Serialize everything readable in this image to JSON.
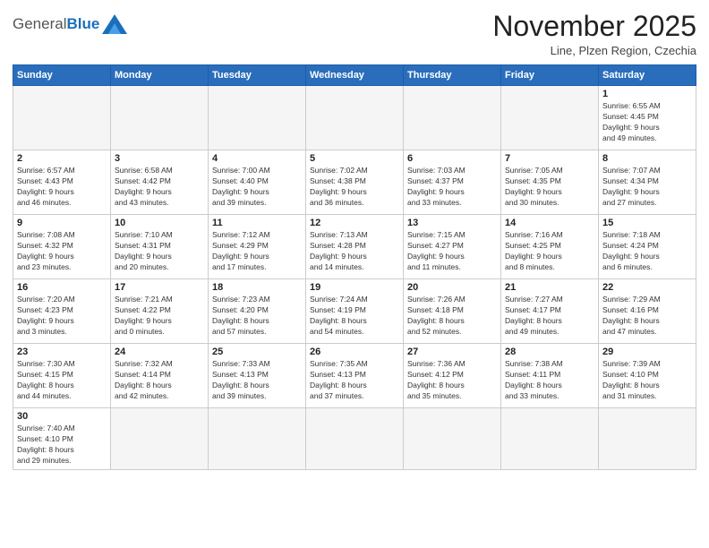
{
  "header": {
    "logo_general": "General",
    "logo_blue": "Blue",
    "title": "November 2025",
    "subtitle": "Line, Plzen Region, Czechia"
  },
  "weekdays": [
    "Sunday",
    "Monday",
    "Tuesday",
    "Wednesday",
    "Thursday",
    "Friday",
    "Saturday"
  ],
  "weeks": [
    [
      {
        "day": "",
        "info": ""
      },
      {
        "day": "",
        "info": ""
      },
      {
        "day": "",
        "info": ""
      },
      {
        "day": "",
        "info": ""
      },
      {
        "day": "",
        "info": ""
      },
      {
        "day": "",
        "info": ""
      },
      {
        "day": "1",
        "info": "Sunrise: 6:55 AM\nSunset: 4:45 PM\nDaylight: 9 hours\nand 49 minutes."
      }
    ],
    [
      {
        "day": "2",
        "info": "Sunrise: 6:57 AM\nSunset: 4:43 PM\nDaylight: 9 hours\nand 46 minutes."
      },
      {
        "day": "3",
        "info": "Sunrise: 6:58 AM\nSunset: 4:42 PM\nDaylight: 9 hours\nand 43 minutes."
      },
      {
        "day": "4",
        "info": "Sunrise: 7:00 AM\nSunset: 4:40 PM\nDaylight: 9 hours\nand 39 minutes."
      },
      {
        "day": "5",
        "info": "Sunrise: 7:02 AM\nSunset: 4:38 PM\nDaylight: 9 hours\nand 36 minutes."
      },
      {
        "day": "6",
        "info": "Sunrise: 7:03 AM\nSunset: 4:37 PM\nDaylight: 9 hours\nand 33 minutes."
      },
      {
        "day": "7",
        "info": "Sunrise: 7:05 AM\nSunset: 4:35 PM\nDaylight: 9 hours\nand 30 minutes."
      },
      {
        "day": "8",
        "info": "Sunrise: 7:07 AM\nSunset: 4:34 PM\nDaylight: 9 hours\nand 27 minutes."
      }
    ],
    [
      {
        "day": "9",
        "info": "Sunrise: 7:08 AM\nSunset: 4:32 PM\nDaylight: 9 hours\nand 23 minutes."
      },
      {
        "day": "10",
        "info": "Sunrise: 7:10 AM\nSunset: 4:31 PM\nDaylight: 9 hours\nand 20 minutes."
      },
      {
        "day": "11",
        "info": "Sunrise: 7:12 AM\nSunset: 4:29 PM\nDaylight: 9 hours\nand 17 minutes."
      },
      {
        "day": "12",
        "info": "Sunrise: 7:13 AM\nSunset: 4:28 PM\nDaylight: 9 hours\nand 14 minutes."
      },
      {
        "day": "13",
        "info": "Sunrise: 7:15 AM\nSunset: 4:27 PM\nDaylight: 9 hours\nand 11 minutes."
      },
      {
        "day": "14",
        "info": "Sunrise: 7:16 AM\nSunset: 4:25 PM\nDaylight: 9 hours\nand 8 minutes."
      },
      {
        "day": "15",
        "info": "Sunrise: 7:18 AM\nSunset: 4:24 PM\nDaylight: 9 hours\nand 6 minutes."
      }
    ],
    [
      {
        "day": "16",
        "info": "Sunrise: 7:20 AM\nSunset: 4:23 PM\nDaylight: 9 hours\nand 3 minutes."
      },
      {
        "day": "17",
        "info": "Sunrise: 7:21 AM\nSunset: 4:22 PM\nDaylight: 9 hours\nand 0 minutes."
      },
      {
        "day": "18",
        "info": "Sunrise: 7:23 AM\nSunset: 4:20 PM\nDaylight: 8 hours\nand 57 minutes."
      },
      {
        "day": "19",
        "info": "Sunrise: 7:24 AM\nSunset: 4:19 PM\nDaylight: 8 hours\nand 54 minutes."
      },
      {
        "day": "20",
        "info": "Sunrise: 7:26 AM\nSunset: 4:18 PM\nDaylight: 8 hours\nand 52 minutes."
      },
      {
        "day": "21",
        "info": "Sunrise: 7:27 AM\nSunset: 4:17 PM\nDaylight: 8 hours\nand 49 minutes."
      },
      {
        "day": "22",
        "info": "Sunrise: 7:29 AM\nSunset: 4:16 PM\nDaylight: 8 hours\nand 47 minutes."
      }
    ],
    [
      {
        "day": "23",
        "info": "Sunrise: 7:30 AM\nSunset: 4:15 PM\nDaylight: 8 hours\nand 44 minutes."
      },
      {
        "day": "24",
        "info": "Sunrise: 7:32 AM\nSunset: 4:14 PM\nDaylight: 8 hours\nand 42 minutes."
      },
      {
        "day": "25",
        "info": "Sunrise: 7:33 AM\nSunset: 4:13 PM\nDaylight: 8 hours\nand 39 minutes."
      },
      {
        "day": "26",
        "info": "Sunrise: 7:35 AM\nSunset: 4:13 PM\nDaylight: 8 hours\nand 37 minutes."
      },
      {
        "day": "27",
        "info": "Sunrise: 7:36 AM\nSunset: 4:12 PM\nDaylight: 8 hours\nand 35 minutes."
      },
      {
        "day": "28",
        "info": "Sunrise: 7:38 AM\nSunset: 4:11 PM\nDaylight: 8 hours\nand 33 minutes."
      },
      {
        "day": "29",
        "info": "Sunrise: 7:39 AM\nSunset: 4:10 PM\nDaylight: 8 hours\nand 31 minutes."
      }
    ],
    [
      {
        "day": "30",
        "info": "Sunrise: 7:40 AM\nSunset: 4:10 PM\nDaylight: 8 hours\nand 29 minutes."
      },
      {
        "day": "",
        "info": ""
      },
      {
        "day": "",
        "info": ""
      },
      {
        "day": "",
        "info": ""
      },
      {
        "day": "",
        "info": ""
      },
      {
        "day": "",
        "info": ""
      },
      {
        "day": "",
        "info": ""
      }
    ]
  ]
}
